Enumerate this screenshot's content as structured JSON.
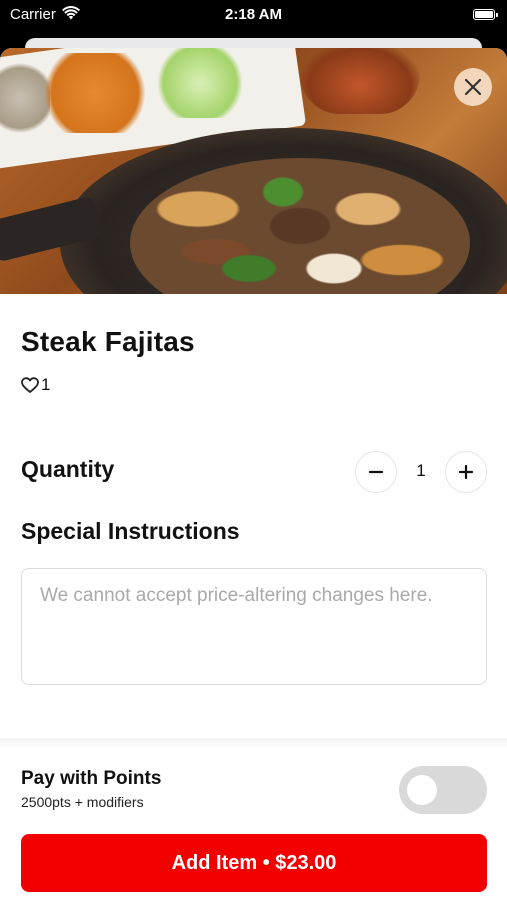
{
  "status_bar": {
    "carrier": "Carrier",
    "time": "2:18 AM"
  },
  "item": {
    "name": "Steak Fajitas",
    "likes": "1"
  },
  "quantity": {
    "label": "Quantity",
    "value": "1"
  },
  "instructions": {
    "label": "Special Instructions",
    "placeholder": "We cannot accept price-altering changes here."
  },
  "points": {
    "title": "Pay with Points",
    "subtitle": "2500pts + modifiers",
    "enabled": false
  },
  "add_button": {
    "label": "Add Item • $23.00"
  },
  "colors": {
    "accent": "#f20000",
    "toggle_off": "#d9d9d9",
    "close_button_bg": "#f5dec8"
  },
  "icons": {
    "close": "close-icon",
    "like": "heart-icon",
    "decrement": "minus-icon",
    "increment": "plus-icon",
    "wifi": "wifi-icon",
    "battery": "battery-icon"
  }
}
